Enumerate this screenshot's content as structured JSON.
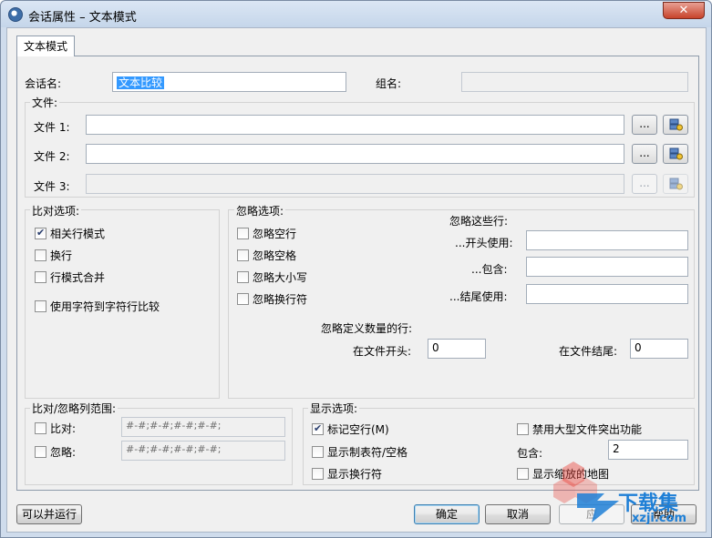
{
  "window": {
    "title": "会话属性 – 文本模式",
    "close_symbol": "✕"
  },
  "tab": {
    "label": "文本模式"
  },
  "session": {
    "name_label": "会话名:",
    "name_value": "文本比较",
    "group_label": "组名:",
    "group_value": ""
  },
  "files": {
    "group_title": "文件:",
    "rows": [
      {
        "label": "文件 1:",
        "value": "",
        "browse": "...",
        "enabled": true
      },
      {
        "label": "文件 2:",
        "value": "",
        "browse": "...",
        "enabled": true
      },
      {
        "label": "文件 3:",
        "value": "",
        "browse": "...",
        "enabled": false
      }
    ]
  },
  "compare": {
    "group_title": "比对选项:",
    "options": [
      {
        "label": "相关行模式",
        "checked": true
      },
      {
        "label": "换行",
        "checked": false
      },
      {
        "label": "行模式合并",
        "checked": false
      },
      {
        "label": "使用字符到字符行比较",
        "checked": false
      }
    ]
  },
  "ignore": {
    "group_title": "忽略选项:",
    "options": [
      {
        "label": "忽略空行",
        "checked": false
      },
      {
        "label": "忽略空格",
        "checked": false
      },
      {
        "label": "忽略大小写",
        "checked": false
      },
      {
        "label": "忽略换行符",
        "checked": false
      }
    ],
    "lines_title": "忽略这些行:",
    "starts_with": "...开头使用:",
    "contains": "...包含:",
    "ends_with": "...结尾使用:",
    "defined_count_title": "忽略定义数量的行:",
    "at_start_label": "在文件开头:",
    "at_start_value": "0",
    "at_end_label": "在文件结尾:",
    "at_end_value": "0"
  },
  "ranges": {
    "group_title": "比对/忽略列范围:",
    "compare_label": "比对:",
    "compare_value": "#-#;#-#;#-#;#-#;",
    "ignore_label": "忽略:",
    "ignore_value": "#-#;#-#;#-#;#-#;"
  },
  "display": {
    "group_title": "显示选项:",
    "mark_blank": {
      "label": "标记空行(M)",
      "checked": true
    },
    "show_tabs": {
      "label": "显示制表符/空格",
      "checked": false
    },
    "show_newlines": {
      "label": "显示换行符",
      "checked": false
    },
    "disable_highlight": {
      "label": "禁用大型文件突出功能",
      "checked": false
    },
    "contains_label": "包含:",
    "contains_value": "2",
    "show_map": {
      "label": "显示缩放的地图",
      "checked": false
    }
  },
  "footer": {
    "run_label": "可以并运行",
    "ok_label": "确定",
    "cancel_label": "取消",
    "apply_label": "应",
    "help_label": "帮助"
  },
  "watermark": {
    "text1": "下载集",
    "text2": "xzji.com"
  },
  "colors": {
    "selection": "#3399ff",
    "watermark_blue": "#1e7fd6",
    "watermark_red": "#e8453c"
  }
}
